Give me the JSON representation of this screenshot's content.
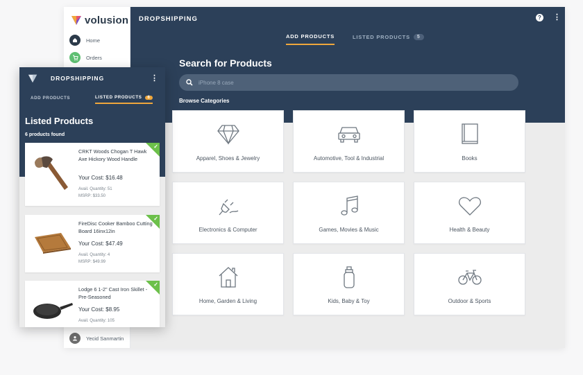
{
  "sidebar": {
    "logo_text": "volusion",
    "items": [
      {
        "label": "Home",
        "icon": "home-icon",
        "color": "#2c3a4a"
      },
      {
        "label": "Orders",
        "icon": "cart-icon",
        "color": "#5fbf73"
      }
    ],
    "user_name": "Yecid Sanmartin"
  },
  "header": {
    "title": "DROPSHIPPING",
    "tabs": [
      {
        "label": "ADD PRODUCTS",
        "active": true
      },
      {
        "label": "LISTED PRODUCTS",
        "count": "5",
        "active": false
      }
    ]
  },
  "search": {
    "heading": "Search for Products",
    "placeholder": "iPhone 8 case",
    "browse_label": "Browse Categories"
  },
  "categories": [
    {
      "label": "Apparel, Shoes & Jewelry",
      "icon": "diamond-icon"
    },
    {
      "label": "Automotive, Tool & Industrial",
      "icon": "car-icon"
    },
    {
      "label": "Books",
      "icon": "book-icon"
    },
    {
      "label": "Electronics & Computer",
      "icon": "plug-icon"
    },
    {
      "label": "Games, Movies & Music",
      "icon": "music-note-icon"
    },
    {
      "label": "Health & Beauty",
      "icon": "heart-icon"
    },
    {
      "label": "Home, Garden & Living",
      "icon": "house-icon"
    },
    {
      "label": "Kids, Baby & Toy",
      "icon": "baby-bottle-icon"
    },
    {
      "label": "Outdoor & Sports",
      "icon": "bicycle-icon"
    }
  ],
  "front_panel": {
    "title": "DROPSHIPPING",
    "tabs": [
      {
        "label": "ADD PRODUCTS",
        "active": false
      },
      {
        "label": "LISTED PRODUCTS",
        "count": "6",
        "active": true
      }
    ],
    "heading": "Listed Products",
    "found_text": "6 products found",
    "products": [
      {
        "name": "CRKT Woods Chogan T Hawk Axe Hickory Wood Handle",
        "cost": "Your Cost: $16.48",
        "qty": "Avail. Quantity: 51",
        "msrp": "MSRP: $33.50"
      },
      {
        "name": "FireDisc Cooker Bamboo Cutting Board 16inx12in",
        "cost": "Your Cost: $47.49",
        "qty": "Avail. Quantity: 4",
        "msrp": "MSRP: $49.99"
      },
      {
        "name": "Lodge 6 1-2\" Cast Iron Skillet - Pre-Seasoned",
        "cost": "Your Cost: $8.95",
        "qty": "Avail. Quantity: 105",
        "msrp": ""
      }
    ]
  },
  "colors": {
    "navy": "#2c4059",
    "accent": "#f0a73c",
    "check_green": "#6cc04a"
  }
}
